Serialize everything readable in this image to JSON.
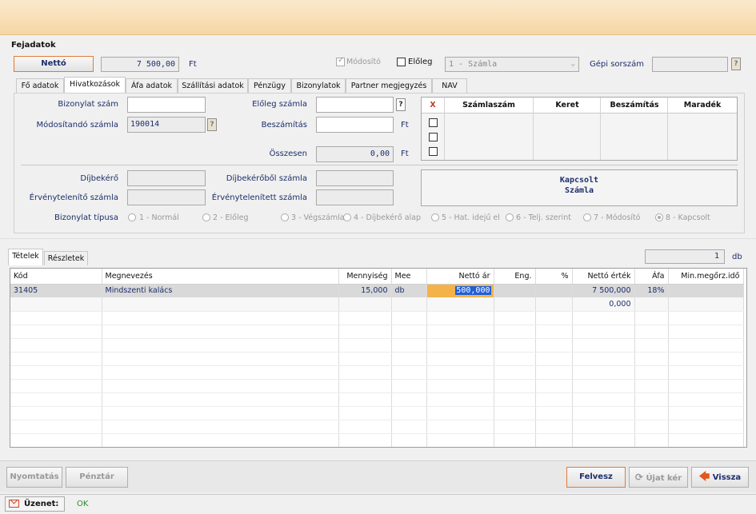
{
  "header": {
    "section_title": "Fejadatok"
  },
  "top_row": {
    "netto_button": "Nettó",
    "netto_value": "7 500,00",
    "currency": "Ft",
    "modosito_label": "Módosító",
    "eloleg_label": "Előleg",
    "invoice_type_value": "1 - Számla",
    "gepi_sorszam_label": "Gépi sorszám",
    "help": "?"
  },
  "tabs": [
    "Fő adatok",
    "Hivatkozások",
    "Áfa adatok",
    "Szállítási adatok",
    "Pénzügy",
    "Bizonylatok",
    "Partner megjegyzés",
    "NAV"
  ],
  "form": {
    "bizonylat_szam_label": "Bizonylat szám",
    "modositando_szamla_label": "Módosítandó számla",
    "modositando_szamla_value": "190014",
    "eloleg_szamla_label": "Előleg számla",
    "beszamitas_label": "Beszámítás",
    "osszesen_label": "Összesen",
    "osszesen_value": "0,00",
    "ft1": "Ft",
    "ft2": "Ft",
    "ft3": "Ft",
    "dijbekero_label": "Díjbekérő",
    "ervenyteleníto_label": "Érvénytelenítő számla",
    "dijbekerobol_label": "Díjbekérőből számla",
    "ervenytelenitett_label": "Érvénytelenített számla",
    "kapcsolt_line1": "Kapcsolt",
    "kapcsolt_line2": "Számla",
    "bizonylat_tipusa_label": "Bizonylat típusa",
    "radios": [
      "1 - Normál",
      "2 - Előleg",
      "3 - Végszámla",
      "4 - Díjbekérő alap",
      "5 - Hat. idejű el",
      "6 - Telj. szerint",
      "7 - Módosító",
      "8 - Kapcsolt"
    ]
  },
  "ref_grid": {
    "headers": [
      "X",
      "Számlaszám",
      "Keret",
      "Beszámítás",
      "Maradék"
    ]
  },
  "items_tabs": [
    "Tételek",
    "Részletek"
  ],
  "item_count": {
    "value": "1",
    "unit": "db"
  },
  "items_table": {
    "headers": [
      "Kód",
      "Megnevezés",
      "Mennyiség",
      "Mee",
      "Nettó ár",
      "Eng.",
      "%",
      "Nettó érték",
      "Áfa",
      "Min.megőrz.idő"
    ],
    "rows": [
      {
        "kod": "31405",
        "megnevezes": "Mindszenti kalács",
        "mennyiseg": "15,000",
        "mee": "db",
        "netto_ar": "500,000",
        "eng": "",
        "pct": "",
        "netto_ertek": "7 500,000",
        "afa": "18%",
        "min": ""
      },
      {
        "kod": "",
        "megnevezes": "",
        "mennyiseg": "",
        "mee": "",
        "netto_ar": "",
        "eng": "",
        "pct": "",
        "netto_ertek": "0,000",
        "afa": "",
        "min": ""
      }
    ]
  },
  "bottom_buttons": {
    "nyomtatas": "Nyomtatás",
    "penztar": "Pénztár",
    "felvesz": "Felvesz",
    "ujat_ker": "Újat kér",
    "vissza": "Vissza"
  },
  "status": {
    "label": "Üzenet:",
    "message": "OK"
  },
  "colors": {
    "accent_orange": "#f4b24a",
    "selection_blue": "#1f5fd6",
    "label_navy": "#1c2e6b"
  }
}
